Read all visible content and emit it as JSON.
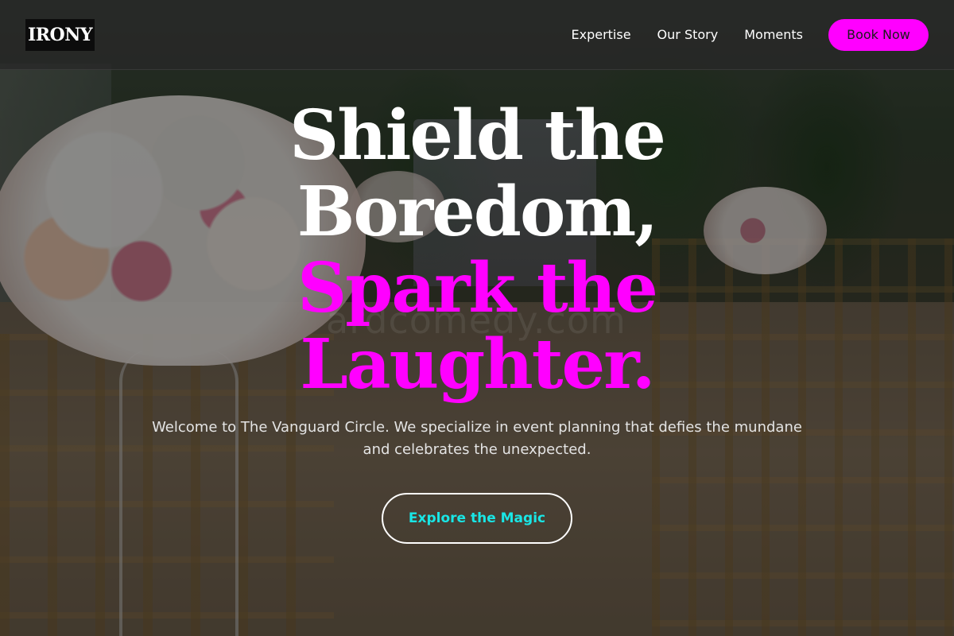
{
  "header": {
    "logo": "IRONY",
    "nav": [
      {
        "label": "Expertise"
      },
      {
        "label": "Our Story"
      },
      {
        "label": "Moments"
      }
    ],
    "book_label": "Book Now"
  },
  "hero": {
    "headline_lines": [
      "Shield the",
      "Boredom,",
      "Spark the",
      "Laughter."
    ],
    "intro_line1": "Welcome to The Vanguard Circle. We specialize in event planning that defies the mundane",
    "intro_line2": "and celebrates the unexpected.",
    "cta_label": "Explore the Magic",
    "watermark": "ardcomedy.com"
  },
  "colors": {
    "accent": "#ff00ff",
    "cta_text": "#19e6e6",
    "header_bg": "#282828",
    "logo_bg": "#0c0c0c"
  }
}
